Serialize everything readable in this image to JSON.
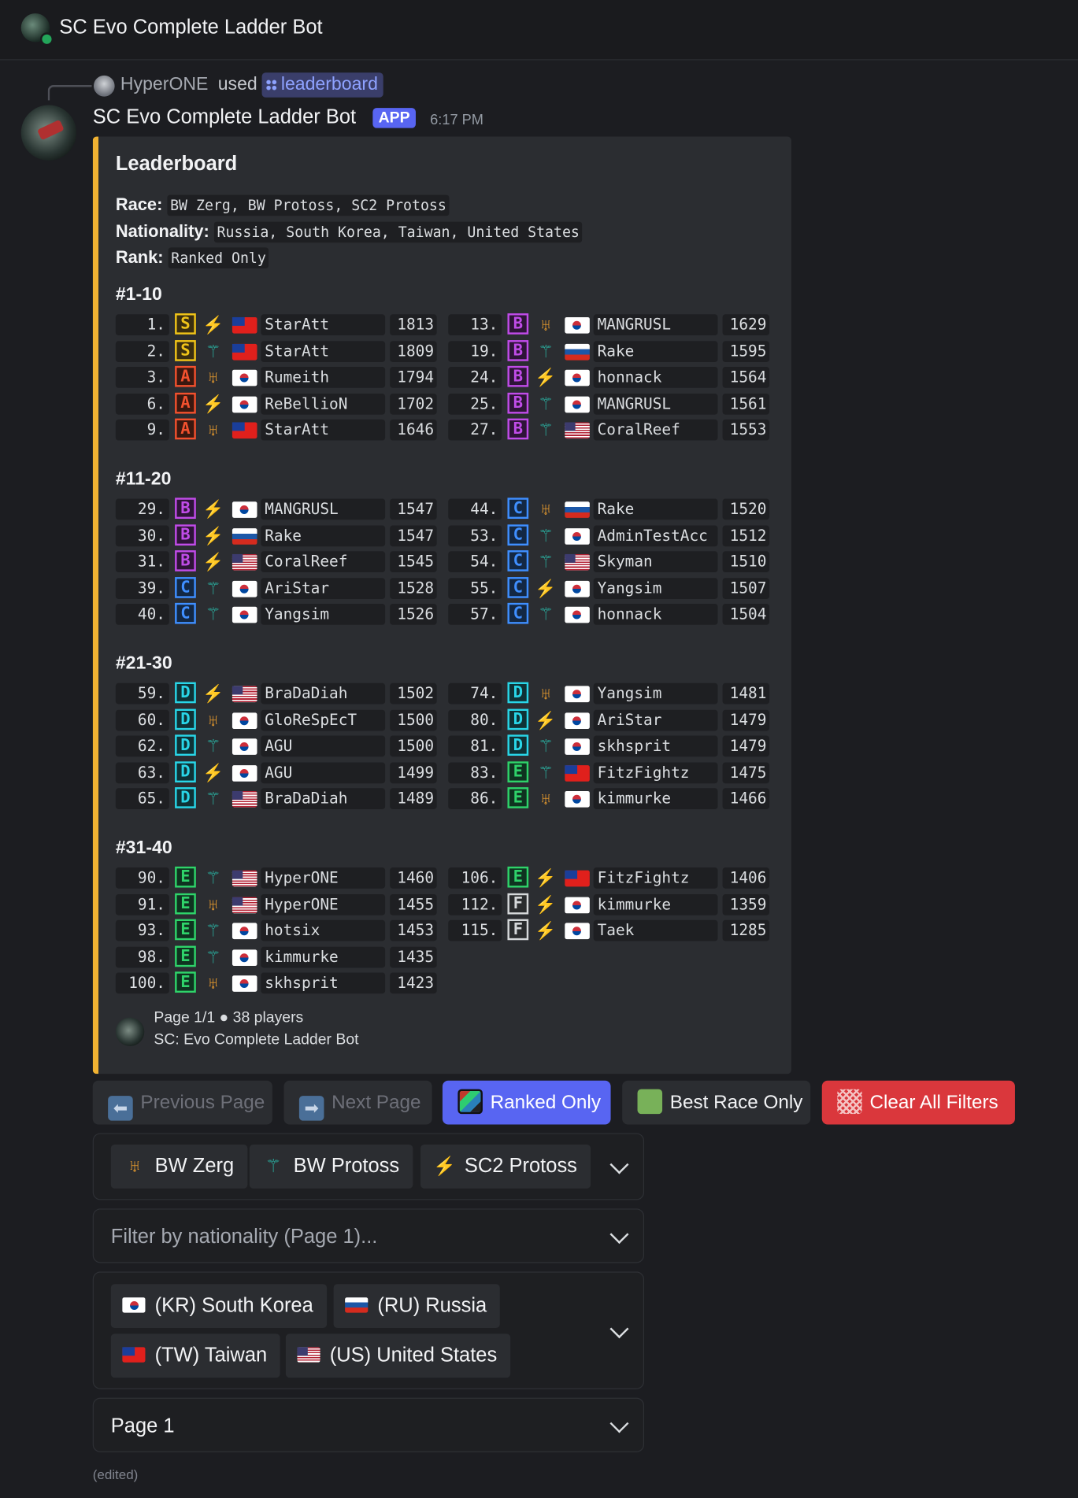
{
  "channel": {
    "title": "SC Evo Complete Ladder Bot"
  },
  "reply": {
    "user": "HyperONE",
    "used": "used",
    "command": "leaderboard"
  },
  "message": {
    "author": "SC Evo Complete Ladder Bot",
    "badge": "APP",
    "time": "6:17 PM",
    "edited": "(edited)"
  },
  "embed": {
    "title": "Leaderboard",
    "accent_color": "#f0b232",
    "filters": [
      {
        "label": "Race:",
        "value": "BW Zerg, BW Protoss, SC2 Protoss"
      },
      {
        "label": "Nationality:",
        "value": "Russia, South Korea, Taiwan, United States"
      },
      {
        "label": "Rank:",
        "value": "Ranked Only"
      }
    ],
    "sections": [
      {
        "title": "#1-10",
        "left": [
          {
            "rank": "1.",
            "tier": "S",
            "race": "sc2-protoss-icon",
            "flag": "TW",
            "name": "StarAtt",
            "score": "1813"
          },
          {
            "rank": "2.",
            "tier": "S",
            "race": "bw-protoss-icon",
            "flag": "TW",
            "name": "StarAtt",
            "score": "1809"
          },
          {
            "rank": "3.",
            "tier": "A",
            "race": "bw-zerg-icon",
            "flag": "KR",
            "name": "Rumeith",
            "score": "1794"
          },
          {
            "rank": "6.",
            "tier": "A",
            "race": "sc2-protoss-icon",
            "flag": "KR",
            "name": "ReBellioN",
            "score": "1702"
          },
          {
            "rank": "9.",
            "tier": "A",
            "race": "bw-zerg-icon",
            "flag": "TW",
            "name": "StarAtt",
            "score": "1646"
          }
        ],
        "right": [
          {
            "rank": "13.",
            "tier": "B",
            "race": "bw-zerg-icon",
            "flag": "KR",
            "name": "MANGRUSL",
            "score": "1629"
          },
          {
            "rank": "19.",
            "tier": "B",
            "race": "bw-protoss-icon",
            "flag": "RU",
            "name": "Rake",
            "score": "1595"
          },
          {
            "rank": "24.",
            "tier": "B",
            "race": "sc2-protoss-icon",
            "flag": "KR",
            "name": "honnack",
            "score": "1564"
          },
          {
            "rank": "25.",
            "tier": "B",
            "race": "bw-protoss-icon",
            "flag": "KR",
            "name": "MANGRUSL",
            "score": "1561"
          },
          {
            "rank": "27.",
            "tier": "B",
            "race": "bw-protoss-icon",
            "flag": "US",
            "name": "CoralReef",
            "score": "1553"
          }
        ]
      },
      {
        "title": "#11-20",
        "left": [
          {
            "rank": "29.",
            "tier": "B",
            "race": "sc2-protoss-icon",
            "flag": "KR",
            "name": "MANGRUSL",
            "score": "1547"
          },
          {
            "rank": "30.",
            "tier": "B",
            "race": "sc2-protoss-icon",
            "flag": "RU",
            "name": "Rake",
            "score": "1547"
          },
          {
            "rank": "31.",
            "tier": "B",
            "race": "sc2-protoss-icon",
            "flag": "US",
            "name": "CoralReef",
            "score": "1545"
          },
          {
            "rank": "39.",
            "tier": "C",
            "race": "bw-protoss-icon",
            "flag": "KR",
            "name": "AriStar",
            "score": "1528"
          },
          {
            "rank": "40.",
            "tier": "C",
            "race": "bw-protoss-icon",
            "flag": "KR",
            "name": "Yangsim",
            "score": "1526"
          }
        ],
        "right": [
          {
            "rank": "44.",
            "tier": "C",
            "race": "bw-zerg-icon",
            "flag": "RU",
            "name": "Rake",
            "score": "1520"
          },
          {
            "rank": "53.",
            "tier": "C",
            "race": "bw-protoss-icon",
            "flag": "KR",
            "name": "AdminTestAcc",
            "score": "1512"
          },
          {
            "rank": "54.",
            "tier": "C",
            "race": "bw-protoss-icon",
            "flag": "US",
            "name": "Skyman",
            "score": "1510"
          },
          {
            "rank": "55.",
            "tier": "C",
            "race": "sc2-protoss-icon",
            "flag": "KR",
            "name": "Yangsim",
            "score": "1507"
          },
          {
            "rank": "57.",
            "tier": "C",
            "race": "bw-protoss-icon",
            "flag": "KR",
            "name": "honnack",
            "score": "1504"
          }
        ]
      },
      {
        "title": "#21-30",
        "left": [
          {
            "rank": "59.",
            "tier": "D",
            "race": "sc2-protoss-icon",
            "flag": "US",
            "name": "BraDaDiah",
            "score": "1502"
          },
          {
            "rank": "60.",
            "tier": "D",
            "race": "bw-zerg-icon",
            "flag": "KR",
            "name": "GloReSpEcT",
            "score": "1500"
          },
          {
            "rank": "62.",
            "tier": "D",
            "race": "bw-protoss-icon",
            "flag": "KR",
            "name": "AGU",
            "score": "1500"
          },
          {
            "rank": "63.",
            "tier": "D",
            "race": "sc2-protoss-icon",
            "flag": "KR",
            "name": "AGU",
            "score": "1499"
          },
          {
            "rank": "65.",
            "tier": "D",
            "race": "bw-protoss-icon",
            "flag": "US",
            "name": "BraDaDiah",
            "score": "1489"
          }
        ],
        "right": [
          {
            "rank": "74.",
            "tier": "D",
            "race": "bw-zerg-icon",
            "flag": "KR",
            "name": "Yangsim",
            "score": "1481"
          },
          {
            "rank": "80.",
            "tier": "D",
            "race": "sc2-protoss-icon",
            "flag": "KR",
            "name": "AriStar",
            "score": "1479"
          },
          {
            "rank": "81.",
            "tier": "D",
            "race": "bw-protoss-icon",
            "flag": "KR",
            "name": "skhsprit",
            "score": "1479"
          },
          {
            "rank": "83.",
            "tier": "E",
            "race": "bw-protoss-icon",
            "flag": "TW",
            "name": "FitzFightz",
            "score": "1475"
          },
          {
            "rank": "86.",
            "tier": "E",
            "race": "bw-zerg-icon",
            "flag": "KR",
            "name": "kimmurke",
            "score": "1466"
          }
        ]
      },
      {
        "title": "#31-40",
        "left": [
          {
            "rank": "90.",
            "tier": "E",
            "race": "bw-protoss-icon",
            "flag": "US",
            "name": "HyperONE",
            "score": "1460"
          },
          {
            "rank": "91.",
            "tier": "E",
            "race": "bw-zerg-icon",
            "flag": "US",
            "name": "HyperONE",
            "score": "1455"
          },
          {
            "rank": "93.",
            "tier": "E",
            "race": "bw-protoss-icon",
            "flag": "KR",
            "name": "hotsix",
            "score": "1453"
          },
          {
            "rank": "98.",
            "tier": "E",
            "race": "bw-protoss-icon",
            "flag": "KR",
            "name": "kimmurke",
            "score": "1435"
          },
          {
            "rank": "100.",
            "tier": "E",
            "race": "bw-zerg-icon",
            "flag": "KR",
            "name": "skhsprit",
            "score": "1423"
          }
        ],
        "right": [
          {
            "rank": "106.",
            "tier": "E",
            "race": "sc2-protoss-icon",
            "flag": "TW",
            "name": "FitzFightz",
            "score": "1406"
          },
          {
            "rank": "112.",
            "tier": "F",
            "race": "sc2-protoss-icon",
            "flag": "KR",
            "name": "kimmurke",
            "score": "1359"
          },
          {
            "rank": "115.",
            "tier": "F",
            "race": "sc2-protoss-icon",
            "flag": "KR",
            "name": "Taek",
            "score": "1285"
          }
        ]
      }
    ],
    "footer": {
      "line1": "Page 1/1 ● 38 players",
      "line2": "SC: Evo Complete Ladder Bot"
    }
  },
  "buttons": {
    "prev": {
      "label": "Previous Page",
      "icon": "arrow-left-icon"
    },
    "next": {
      "label": "Next Page",
      "icon": "arrow-right-icon"
    },
    "ranked": {
      "label": "Ranked Only",
      "icon": "ranked-icon"
    },
    "best": {
      "label": "Best Race Only",
      "icon": "green-square-icon"
    },
    "clear": {
      "label": "Clear All Filters",
      "icon": "clear-icon"
    }
  },
  "race_select": {
    "chips": [
      {
        "label": "BW Zerg",
        "icon": "bw-zerg-icon"
      },
      {
        "label": "BW Protoss",
        "icon": "bw-protoss-icon"
      },
      {
        "label": "SC2 Protoss",
        "icon": "sc2-protoss-icon"
      }
    ]
  },
  "nationality_page_select": {
    "placeholder": "Filter by nationality (Page 1)..."
  },
  "nationality_select": {
    "chips": [
      {
        "label": "(KR) South Korea",
        "flag": "KR"
      },
      {
        "label": "(RU) Russia",
        "flag": "RU"
      },
      {
        "label": "(TW) Taiwan",
        "flag": "TW"
      },
      {
        "label": "(US) United States",
        "flag": "US"
      }
    ]
  },
  "page_select": {
    "value": "Page 1"
  }
}
